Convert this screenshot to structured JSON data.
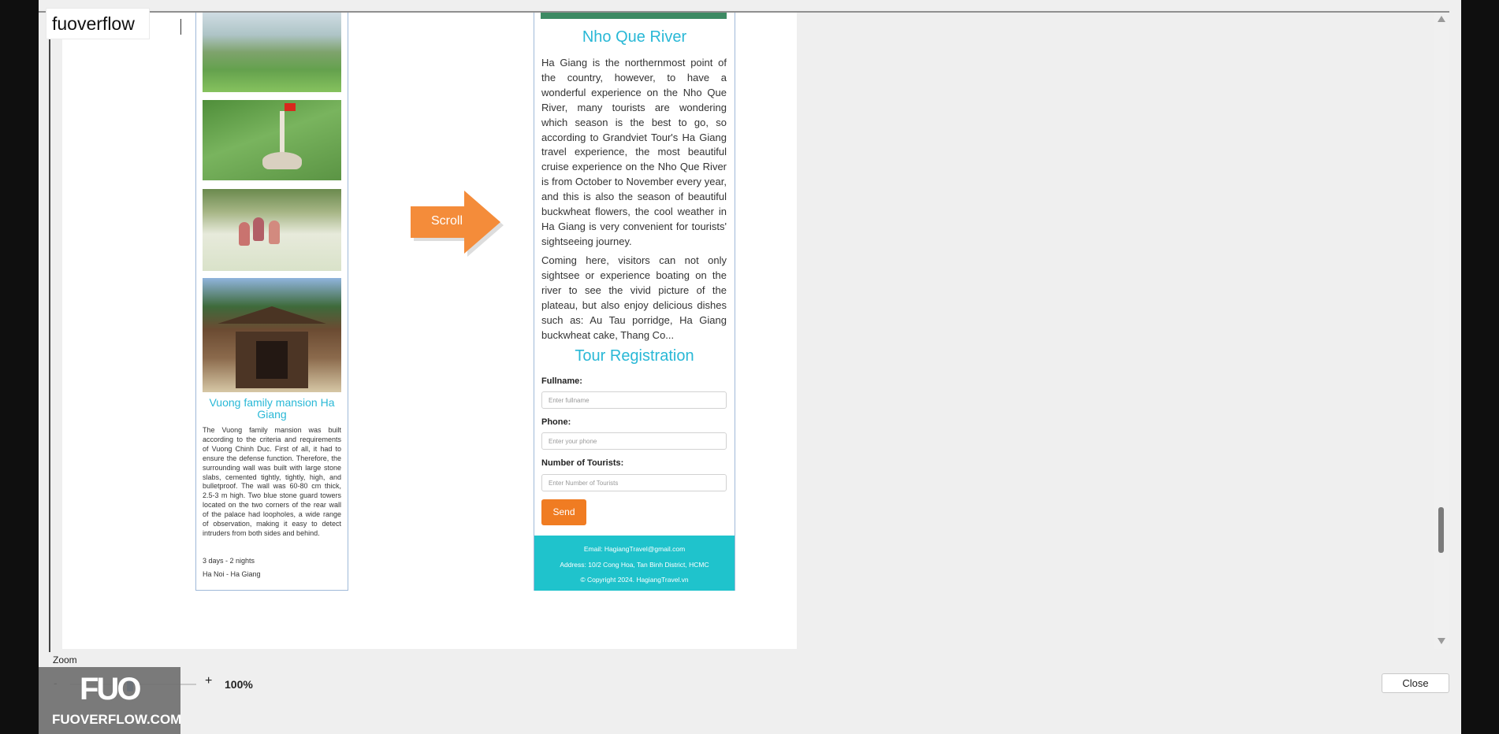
{
  "window": {
    "title": "fuoverflow"
  },
  "preview": {
    "mansion": {
      "title": "Vuong family mansion Ha Giang",
      "description": "The Vuong family mansion was built according to the criteria and requirements of Vuong Chinh Duc. First of all, it had to ensure the defense function. Therefore, the surrounding wall was built with large stone slabs, cemented tightly, tightly, high, and bulletproof. The wall was 60-80 cm thick, 2.5-3 m high. Two blue stone guard towers located on the two corners of the rear wall of the palace had loopholes, a wide range of observation, making it easy to detect intruders from both sides and behind.",
      "duration": "3 days - 2 nights",
      "route": "Ha Noi - Ha Giang"
    },
    "scroll_label": "Scroll",
    "river": {
      "title": "Nho Que River",
      "paragraph_1": "Ha Giang is the northernmost point of the country, however, to have a wonderful experience on the Nho Que River, many tourists are wondering which season is the best to go, so according to Grandviet Tour's Ha Giang travel experience, the most beautiful cruise experience on the Nho Que River is from October to November every year, and this is also the season of beautiful buckwheat flowers, the cool weather in Ha Giang is very convenient for tourists' sightseeing journey.",
      "paragraph_2": "Coming here, visitors can not only sightsee or experience boating on the river to see the vivid picture of the plateau, but also enjoy delicious dishes such as: Au Tau porridge, Ha Giang buckwheat cake, Thang Co..."
    },
    "registration": {
      "title": "Tour Registration",
      "fullname_label": "Fullname:",
      "fullname_placeholder": "Enter fullname",
      "phone_label": "Phone:",
      "phone_placeholder": "Enter your phone",
      "tourists_label": "Number of Tourists:",
      "tourists_placeholder": "Enter Number of Tourists",
      "send_label": "Send"
    },
    "footer": {
      "email": "Email: HagiangTravel@gmail.com",
      "address": "Address: 10/2 Cong Hoa, Tan Binh District, HCMC",
      "copyright": "© Copyright 2024. HagiangTravel.vn"
    }
  },
  "controls": {
    "zoom_label": "Zoom",
    "zoom_minus": "-",
    "zoom_plus": "+",
    "zoom_value": "100%",
    "close_label": "Close"
  },
  "watermark": {
    "logo": "FUO",
    "text": "FUOVERFLOW.COM"
  },
  "colors": {
    "heading": "#29b8d6",
    "send_button": "#f07c22",
    "footer": "#1fc3cc"
  }
}
